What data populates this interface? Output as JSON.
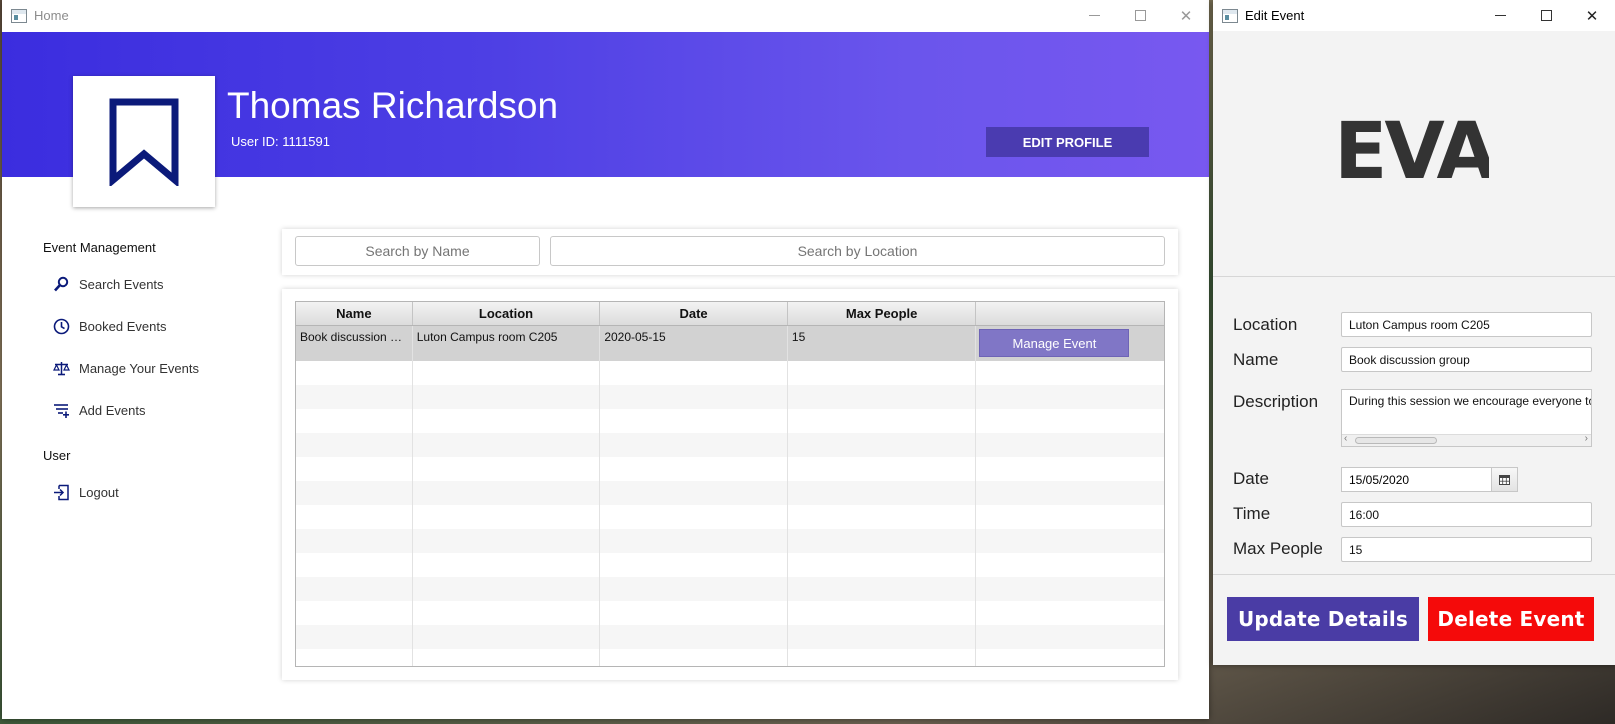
{
  "home_window": {
    "title": "Home",
    "user": {
      "name": "Thomas Richardson",
      "id_label": "User ID: 1111591"
    },
    "edit_profile_label": "EDIT PROFILE",
    "sidebar": {
      "section_event": "Event Management",
      "items": [
        {
          "label": "Search Events",
          "icon": "search-icon"
        },
        {
          "label": "Booked Events",
          "icon": "clock-icon"
        },
        {
          "label": "Manage Your Events",
          "icon": "scales-icon"
        },
        {
          "label": "Add Events",
          "icon": "list-add-icon"
        }
      ],
      "section_user": "User",
      "logout_label": "Logout"
    },
    "search": {
      "name_placeholder": "Search by Name",
      "location_placeholder": "Search by Location"
    },
    "table": {
      "columns": [
        "Name",
        "Location",
        "Date",
        "Max People",
        ""
      ],
      "rows": [
        {
          "name": "Book discussion gr...",
          "location": "Luton Campus room C205",
          "date": "2020-05-15",
          "max_people": "15",
          "action": "Manage Event"
        }
      ]
    }
  },
  "edit_window": {
    "title": "Edit Event",
    "logo_text": "EVA",
    "fields": {
      "location_label": "Location",
      "location_value": "Luton Campus room C205",
      "name_label": "Name",
      "name_value": "Book discussion group",
      "description_label": "Description",
      "description_value": "During this session we encourage everyone to",
      "date_label": "Date",
      "date_value": "15/05/2020",
      "time_label": "Time",
      "time_value": "16:00",
      "max_people_label": "Max People",
      "max_people_value": "15"
    },
    "update_label": "Update Details",
    "delete_label": "Delete Event"
  },
  "colors": {
    "header_gradient_start": "#3b2ddf",
    "header_gradient_end": "#7858f0",
    "primary_button": "#4a3ca5",
    "manage_button": "#8076c6",
    "delete_button": "#f50a0a",
    "icon_navy": "#0b1a7a"
  }
}
